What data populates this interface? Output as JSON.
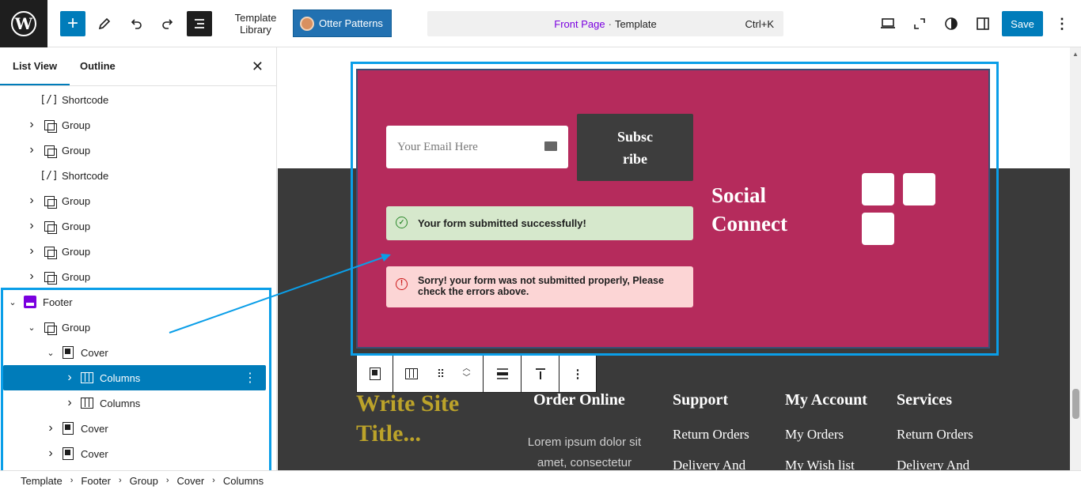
{
  "topbar": {
    "template_library": "Template Library",
    "otter_patterns": "Otter Patterns",
    "command": {
      "front_page": "Front Page",
      "separator": "·",
      "template": "Template",
      "shortcut": "Ctrl+K"
    },
    "save_label": "Save"
  },
  "sidebar": {
    "tabs": [
      "List View",
      "Outline"
    ],
    "items": [
      {
        "label": "Shortcode",
        "icon": "shortcode-icon",
        "has_chevron": false
      },
      {
        "label": "Group",
        "icon": "group-icon",
        "has_chevron": true
      },
      {
        "label": "Group",
        "icon": "group-icon",
        "has_chevron": true
      },
      {
        "label": "Shortcode",
        "icon": "shortcode-icon",
        "has_chevron": false
      },
      {
        "label": "Group",
        "icon": "group-icon",
        "has_chevron": true
      },
      {
        "label": "Group",
        "icon": "group-icon",
        "has_chevron": true
      },
      {
        "label": "Group",
        "icon": "group-icon",
        "has_chevron": true
      },
      {
        "label": "Group",
        "icon": "group-icon",
        "has_chevron": true
      },
      {
        "label": "Footer",
        "icon": "footer-icon",
        "has_chevron": true,
        "expanded": true
      },
      {
        "label": "Group",
        "icon": "group-icon",
        "has_chevron": true,
        "expanded": true
      },
      {
        "label": "Cover",
        "icon": "cover-icon",
        "has_chevron": true,
        "expanded": true
      },
      {
        "label": "Columns",
        "icon": "columns-icon",
        "has_chevron": true,
        "selected": true
      },
      {
        "label": "Columns",
        "icon": "columns-icon",
        "has_chevron": true
      },
      {
        "label": "Cover",
        "icon": "cover-icon",
        "has_chevron": true
      },
      {
        "label": "Cover",
        "icon": "cover-icon",
        "has_chevron": true
      }
    ]
  },
  "canvas": {
    "email_placeholder": "Your Email Here",
    "subscribe_label": "Subsc ribe",
    "success_message": "Your form submitted successfully!",
    "error_message": "Sorry! your form was not submitted properly, Please check the errors above.",
    "social_heading": "Social Connect",
    "site_title": "Write Site Title...",
    "lorem": "Lorem ipsum dolor sit amet, consectetur",
    "columns": [
      {
        "heading": "Order Online",
        "items": []
      },
      {
        "heading": "Support",
        "items": [
          "Return Orders",
          "Delivery And"
        ]
      },
      {
        "heading": "My Account",
        "items": [
          "My Orders",
          "My Wish list"
        ]
      },
      {
        "heading": "Services",
        "items": [
          "Return Orders",
          "Delivery And"
        ]
      }
    ]
  },
  "breadcrumb": [
    "Template",
    "Footer",
    "Group",
    "Cover",
    "Columns"
  ],
  "colors": {
    "accent": "#007cba",
    "cover_bg": "#b52b5c",
    "footer_bg": "#3a3a3a",
    "site_title": "#bca32a",
    "success_bg": "#d6e8cc",
    "error_bg": "#fcd5d5",
    "highlight": "#0a9ee8"
  }
}
